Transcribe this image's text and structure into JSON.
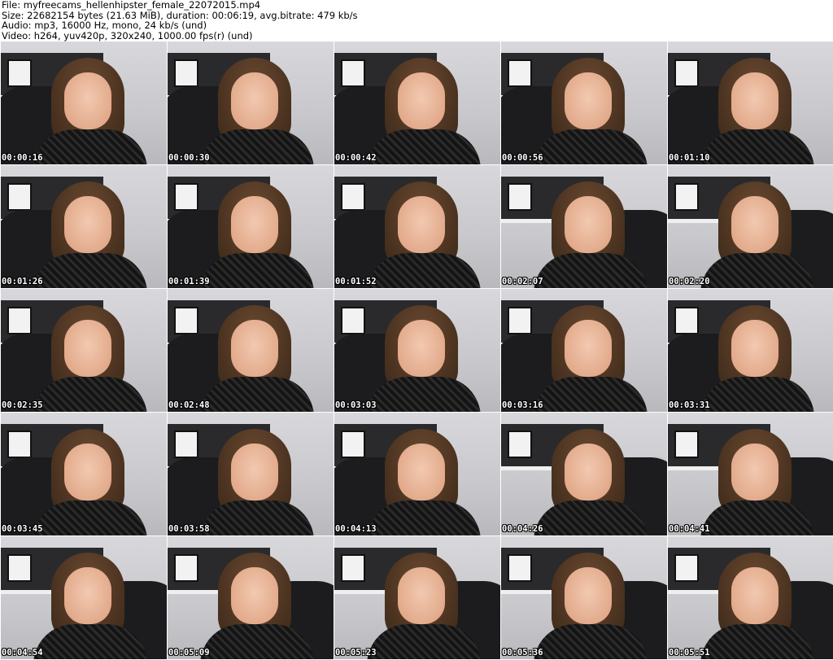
{
  "header": {
    "file": "File: myfreecams_hellenhipster_female_22072015.mp4",
    "size": "Size: 22682154 bytes (21.63 MiB), duration: 00:06:19, avg.bitrate: 479 kb/s",
    "audio": "Audio: mp3, 16000 Hz, mono, 24 kb/s (und)",
    "video": "Video: h264, yuv420p, 320x240, 1000.00 fps(r) (und)"
  },
  "thumbnails": [
    {
      "timestamp": "00:00:16"
    },
    {
      "timestamp": "00:00:30"
    },
    {
      "timestamp": "00:00:42"
    },
    {
      "timestamp": "00:00:56"
    },
    {
      "timestamp": "00:01:10"
    },
    {
      "timestamp": "00:01:26"
    },
    {
      "timestamp": "00:01:39"
    },
    {
      "timestamp": "00:01:52"
    },
    {
      "timestamp": "00:02:07"
    },
    {
      "timestamp": "00:02:20"
    },
    {
      "timestamp": "00:02:35"
    },
    {
      "timestamp": "00:02:48"
    },
    {
      "timestamp": "00:03:03"
    },
    {
      "timestamp": "00:03:16"
    },
    {
      "timestamp": "00:03:31"
    },
    {
      "timestamp": "00:03:45"
    },
    {
      "timestamp": "00:03:58"
    },
    {
      "timestamp": "00:04:13"
    },
    {
      "timestamp": "00:04:26"
    },
    {
      "timestamp": "00:04:41"
    },
    {
      "timestamp": "00:04:54"
    },
    {
      "timestamp": "00:05:09"
    },
    {
      "timestamp": "00:05:23"
    },
    {
      "timestamp": "00:05:36"
    },
    {
      "timestamp": "00:05:51"
    }
  ]
}
